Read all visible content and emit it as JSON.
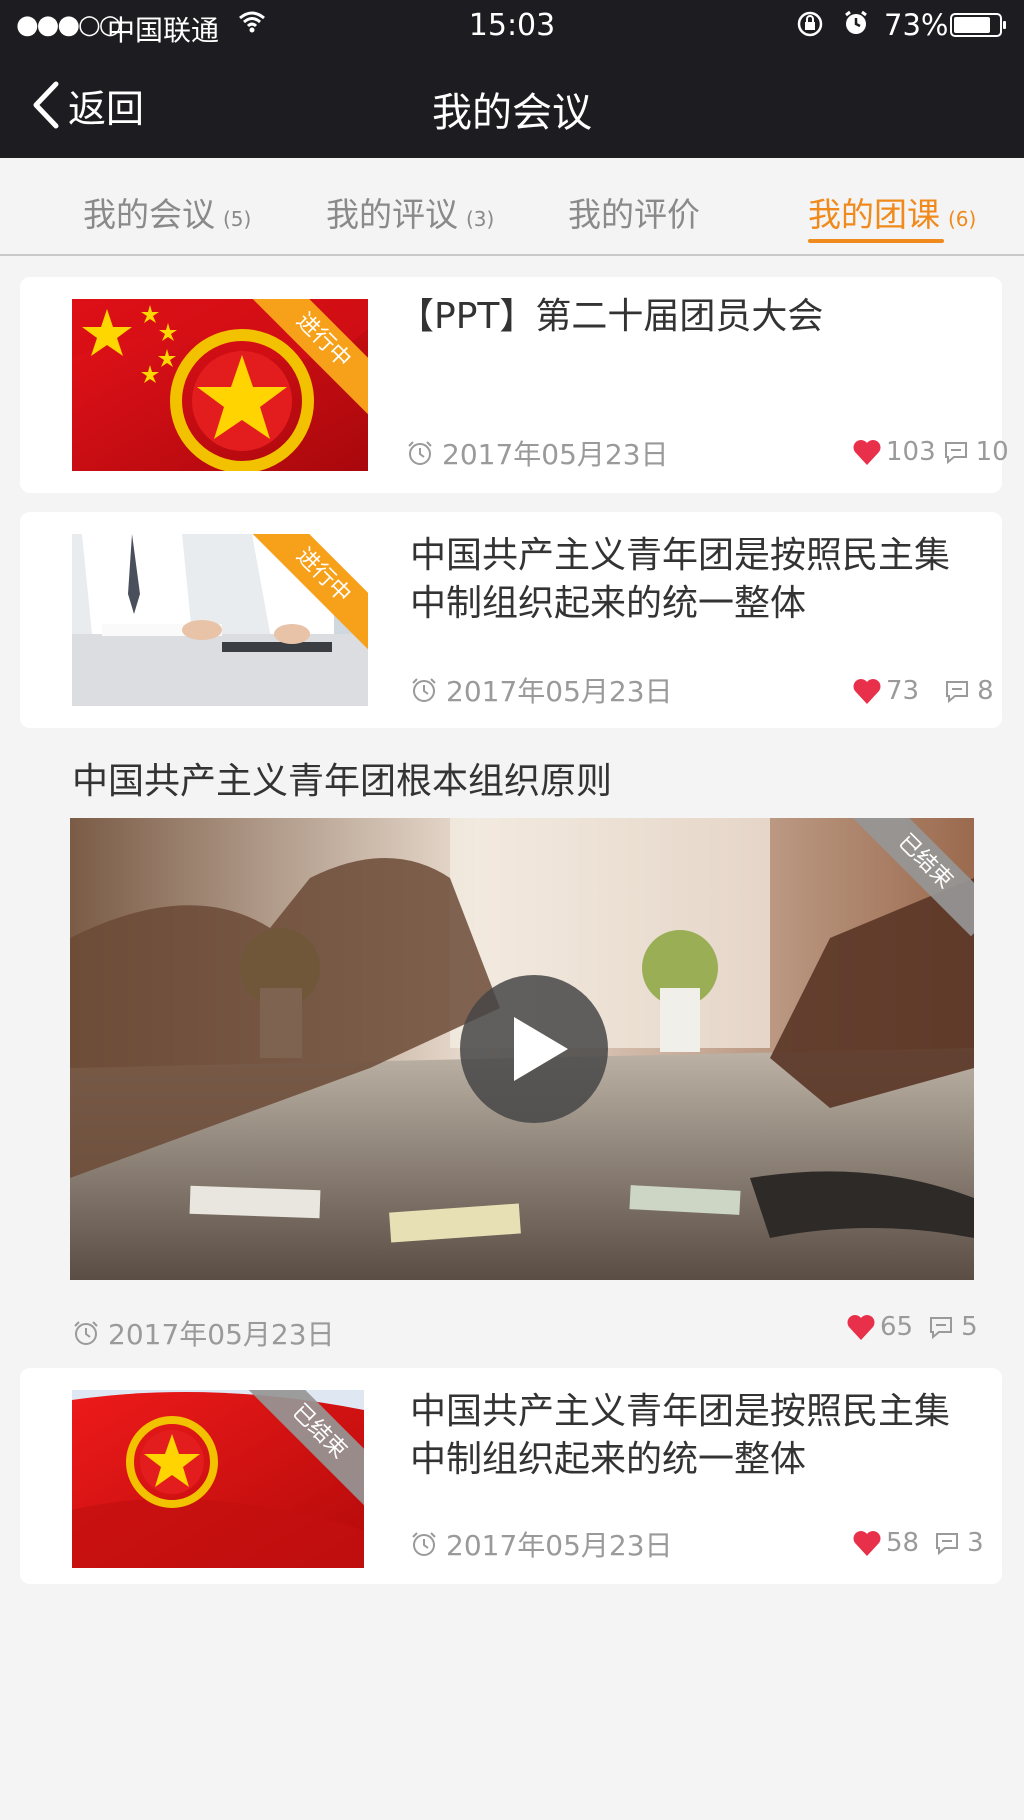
{
  "status_bar": {
    "signal": "●●●○○",
    "carrier": "中国联通",
    "time": "15:03",
    "battery_pct": "73%"
  },
  "nav": {
    "back_label": "返回",
    "title": "我的会议"
  },
  "tabs": [
    {
      "label": "我的会议",
      "count": "(5)"
    },
    {
      "label": "我的评议",
      "count": "(3)"
    },
    {
      "label": "我的评价",
      "count": ""
    },
    {
      "label": "我的团课",
      "count": "(6)",
      "active": true
    }
  ],
  "items": [
    {
      "title": "【PPT】第二十届团员大会",
      "status": "进行中",
      "date": "2017年05月23日",
      "likes": "103",
      "comments": "10"
    },
    {
      "title": "中国共产主义青年团是按照民主集中制组织起来的统一整体",
      "status": "进行中",
      "date": "2017年05月23日",
      "likes": "73",
      "comments": "8"
    },
    {
      "title": "中国共产主义青年团根本组织原则",
      "status": "已结束",
      "date": "2017年05月23日",
      "likes": "65",
      "comments": "5",
      "type": "video"
    },
    {
      "title": "中国共产主义青年团是按照民主集中制组织起来的统一整体",
      "status": "已结束",
      "date": "2017年05月23日",
      "likes": "58",
      "comments": "3"
    }
  ],
  "colors": {
    "accent": "#f08a1c",
    "heart": "#e8304a",
    "nav_bg": "#1d1d21",
    "ribbon_active": "#f7a11a",
    "ribbon_ended": "#969696"
  },
  "icons": [
    "back-chevron-icon",
    "wifi-icon",
    "rotation-lock-icon",
    "alarm-icon",
    "battery-icon",
    "clock-icon",
    "heart-icon",
    "comment-icon",
    "play-icon"
  ]
}
